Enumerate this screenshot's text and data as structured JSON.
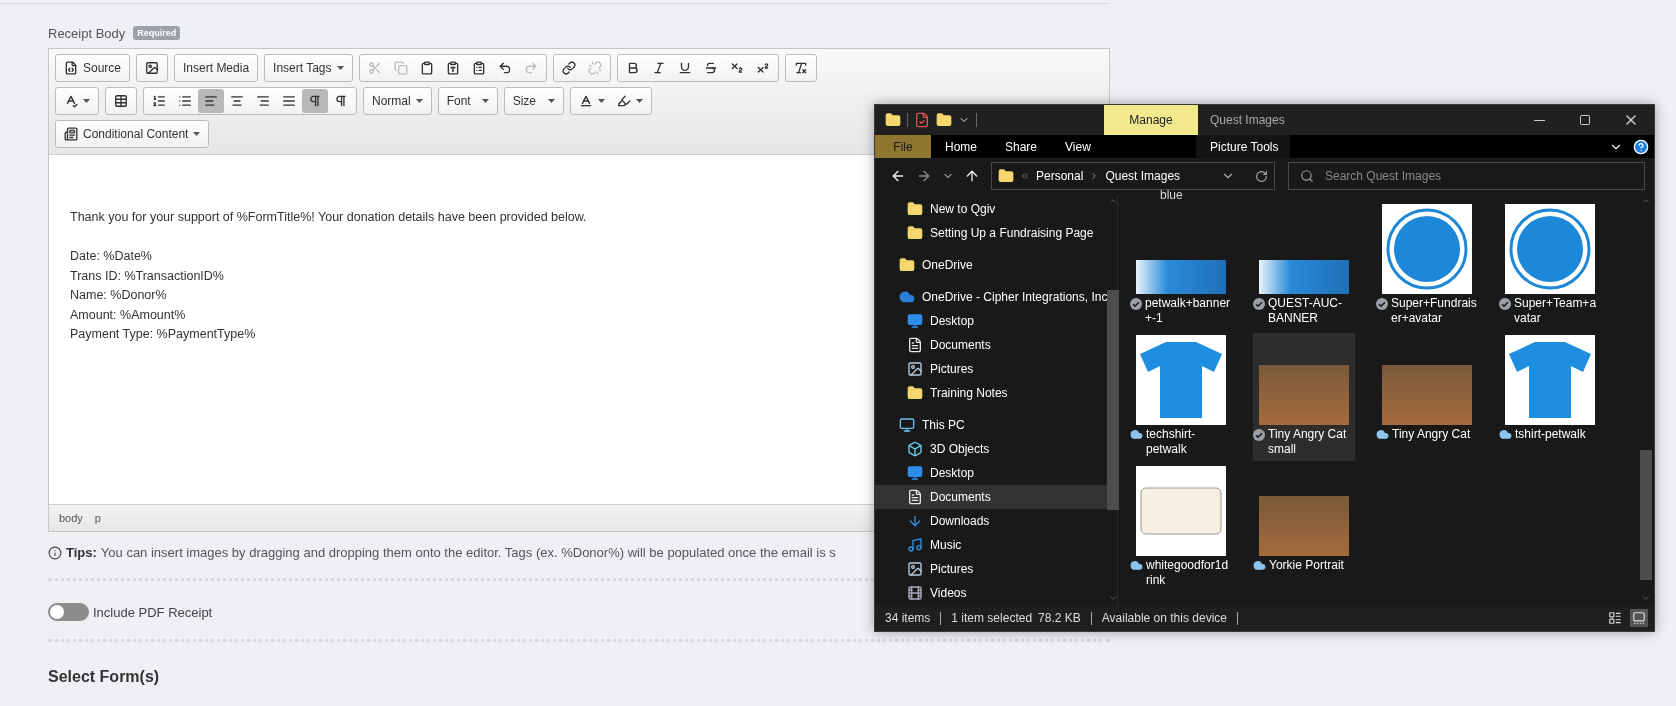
{
  "editor": {
    "label": "Receipt Body",
    "badge": "Required",
    "toolbar": [
      [
        [
          {
            "kind": "source",
            "label": "Source"
          }
        ],
        [
          {
            "kind": "image",
            "disabled": false,
            "on": false
          }
        ],
        [
          {
            "kind": "text",
            "label": "Insert Media"
          }
        ],
        [
          {
            "kind": "select",
            "label": "Insert Tags"
          }
        ],
        [
          {
            "kind": "cut",
            "disabled": true,
            "on": false
          },
          {
            "kind": "copy",
            "disabled": true,
            "on": false
          },
          {
            "kind": "paste",
            "disabled": false,
            "on": false
          },
          {
            "kind": "pastetext",
            "disabled": false,
            "on": false
          },
          {
            "kind": "pasteword",
            "disabled": false,
            "on": false
          },
          {
            "kind": "undo",
            "disabled": false,
            "on": false
          },
          {
            "kind": "redo",
            "disabled": true,
            "on": false
          }
        ],
        [
          {
            "kind": "link",
            "disabled": false,
            "on": false
          },
          {
            "kind": "unlink",
            "disabled": true,
            "on": false
          }
        ],
        [
          {
            "kind": "bold",
            "disabled": false,
            "on": false
          },
          {
            "kind": "italic",
            "disabled": false,
            "on": false
          },
          {
            "kind": "underline",
            "disabled": false,
            "on": false
          },
          {
            "kind": "strike",
            "disabled": false,
            "on": false
          },
          {
            "kind": "sub",
            "disabled": false,
            "on": false
          },
          {
            "kind": "sup",
            "disabled": false,
            "on": false
          }
        ],
        [
          {
            "kind": "clear",
            "disabled": false,
            "on": false
          }
        ]
      ],
      [
        [
          {
            "kind": "spell",
            "disabled": false,
            "on": false
          }
        ],
        [
          {
            "kind": "table",
            "disabled": false,
            "on": false
          }
        ],
        [
          {
            "kind": "ol",
            "disabled": false,
            "on": false
          },
          {
            "kind": "ul",
            "disabled": false,
            "on": false
          },
          {
            "kind": "left",
            "disabled": false,
            "on": true
          },
          {
            "kind": "center",
            "disabled": false,
            "on": false
          },
          {
            "kind": "right",
            "disabled": false,
            "on": false
          },
          {
            "kind": "justify",
            "disabled": false,
            "on": false
          },
          {
            "kind": "ltr",
            "disabled": false,
            "on": true
          },
          {
            "kind": "rtl",
            "disabled": false,
            "on": false
          }
        ],
        [
          {
            "kind": "select",
            "label": "Normal"
          }
        ],
        [
          {
            "kind": "select",
            "label": "Font"
          }
        ],
        [
          {
            "kind": "select",
            "label": "Size"
          }
        ],
        [
          {
            "kind": "textcolor",
            "disabled": false,
            "on": false
          },
          {
            "kind": "bgcolor",
            "disabled": false,
            "on": false
          }
        ]
      ],
      [
        [
          {
            "kind": "conditional",
            "label": "Conditional Content"
          }
        ]
      ]
    ],
    "intro": "Thank you for your support of %FormTitle%! Your donation details have been provided below.",
    "lines": [
      "Date: %Date%",
      "Trans ID: %TransactionID%",
      "Name: %Donor%",
      "Amount: %Amount%",
      "Payment Type: %PaymentType%"
    ],
    "path": [
      "body",
      "p"
    ]
  },
  "tips": {
    "label": "Tips:",
    "text": "You can insert images by dragging and dropping them onto the editor. Tags (ex. %Donor%) will be populated once the email is s"
  },
  "pdf_toggle": {
    "label": "Include PDF Receipt",
    "on": false
  },
  "section_title": "Select Form(s)",
  "explorer": {
    "title": "Quest Images",
    "context_tab": "Manage",
    "ribbon_tabs": [
      {
        "label": "File",
        "kind": "file"
      },
      {
        "label": "Home",
        "kind": "tab"
      },
      {
        "label": "Share",
        "kind": "tab"
      },
      {
        "label": "View",
        "kind": "tab"
      },
      {
        "label": "Picture Tools",
        "kind": "context"
      }
    ],
    "breadcrumb": [
      "Personal",
      "Quest Images"
    ],
    "search": {
      "placeholder": "Search Quest Images"
    },
    "nav_continued": [
      {
        "label": "New to Qgiv",
        "kind": "folder",
        "selected": false
      },
      {
        "label": "Setting Up a Fundraising Page",
        "kind": "folder",
        "selected": false
      }
    ],
    "nav": [
      {
        "label": "OneDrive",
        "kind": "folder",
        "selected": false
      },
      {
        "label": "OneDrive - Cipher Integrations, Inc",
        "kind": "cloud",
        "selected": false,
        "children": [
          {
            "label": "Desktop",
            "kind": "desktop",
            "selected": false
          },
          {
            "label": "Documents",
            "kind": "documents",
            "selected": false
          },
          {
            "label": "Pictures",
            "kind": "pictures",
            "selected": false
          },
          {
            "label": "Training Notes",
            "kind": "folder",
            "selected": false
          }
        ]
      },
      {
        "label": "This PC",
        "kind": "pc",
        "selected": false,
        "children": [
          {
            "label": "3D Objects",
            "kind": "cube",
            "selected": false
          },
          {
            "label": "Desktop",
            "kind": "desktop",
            "selected": false
          },
          {
            "label": "Documents",
            "kind": "documents",
            "selected": true
          },
          {
            "label": "Downloads",
            "kind": "downloads",
            "selected": false
          },
          {
            "label": "Music",
            "kind": "music",
            "selected": false
          },
          {
            "label": "Pictures",
            "kind": "pictures",
            "selected": false
          },
          {
            "label": "Videos",
            "kind": "videos",
            "selected": false
          }
        ]
      }
    ],
    "partial_label": "blue",
    "files": [
      {
        "label": "petwalk+banner+-1",
        "kind": "banner",
        "synced": true,
        "selected": false
      },
      {
        "label": "QUEST-AUC-BANNER",
        "kind": "banner",
        "synced": true,
        "selected": false
      },
      {
        "label": "Super+Fundraiser+avatar",
        "kind": "badge",
        "synced": true,
        "selected": false
      },
      {
        "label": "Super+Team+avatar",
        "kind": "badge",
        "synced": true,
        "selected": false
      },
      {
        "label": "techshirt-petwalk",
        "kind": "shirt",
        "synced": false,
        "selected": false
      },
      {
        "label": "Tiny Angry Cat small",
        "kind": "photo",
        "synced": true,
        "selected": true
      },
      {
        "label": "Tiny Angry Cat",
        "kind": "photo",
        "synced": false,
        "selected": false
      },
      {
        "label": "tshirt-petwalk",
        "kind": "shirt",
        "synced": false,
        "selected": false
      },
      {
        "label": "whitegoodfor1drink",
        "kind": "ticket",
        "synced": false,
        "selected": false
      },
      {
        "label": "Yorkie Portrait",
        "kind": "photo",
        "synced": false,
        "selected": false
      }
    ],
    "status": [
      "34 items",
      "1 item selected",
      "78.2 KB",
      "Available on this device"
    ]
  }
}
